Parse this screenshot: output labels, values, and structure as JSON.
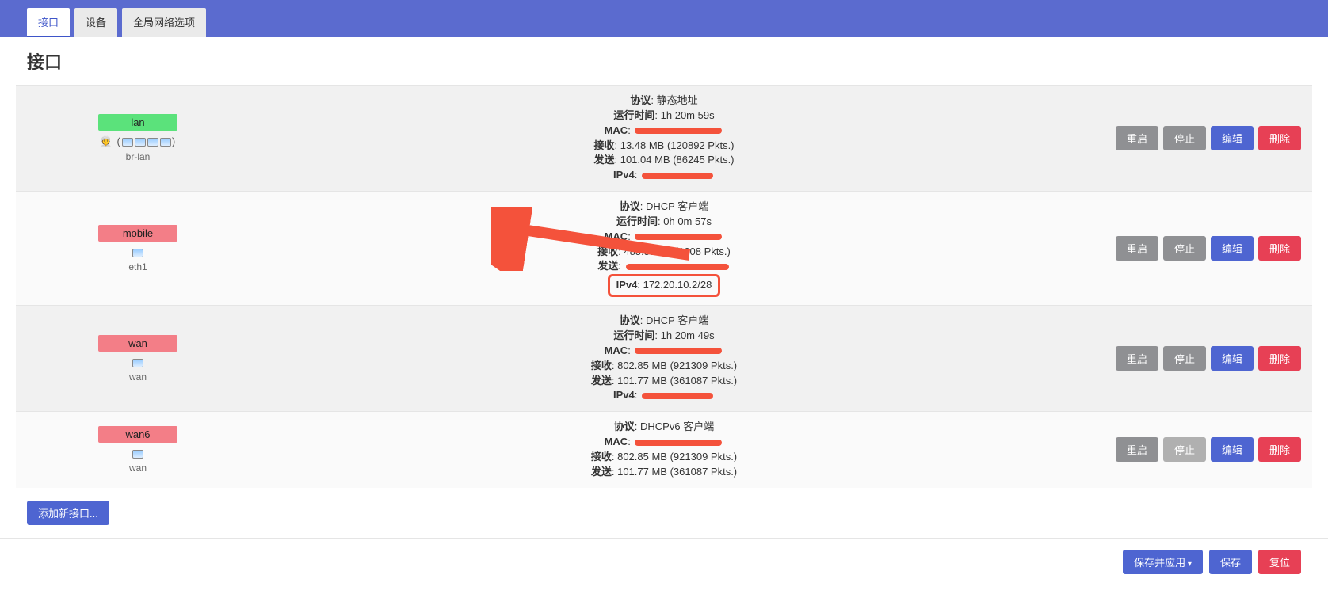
{
  "tabs": {
    "interfaces": "接口",
    "devices": "设备",
    "global": "全局网络选项"
  },
  "page_title": "接口",
  "labels": {
    "protocol": "协议",
    "uptime": "运行时间",
    "mac": "MAC",
    "rx": "接收",
    "tx": "发送",
    "ipv4": "IPv4"
  },
  "actions": {
    "restart": "重启",
    "stop": "停止",
    "edit": "编辑",
    "delete": "删除",
    "add": "添加新接口...",
    "save_apply": "保存并应用",
    "save": "保存",
    "reset": "复位"
  },
  "interfaces": [
    {
      "name": "lan",
      "badge_class": "badge-green",
      "device": "br-lan",
      "icons": 4,
      "protocol": "静态地址",
      "uptime": "1h 20m 59s",
      "mac_redacted": true,
      "rx": "13.48 MB (120892 Pkts.)",
      "tx": "101.04 MB (86245 Pkts.)",
      "ipv4_redacted": true,
      "ipv4": null,
      "stop_disabled": false
    },
    {
      "name": "mobile",
      "badge_class": "badge-red",
      "device": "eth1",
      "icons": 1,
      "protocol": "DHCP 客户端",
      "uptime": "0h 0m 57s",
      "mac_redacted": true,
      "rx": "485.58 KB (1608 Pkts.)",
      "tx_redacted": true,
      "ipv4": "172.20.10.2/28",
      "ipv4_highlight": true,
      "stop_disabled": false
    },
    {
      "name": "wan",
      "badge_class": "badge-red",
      "device": "wan",
      "icons": 1,
      "protocol": "DHCP 客户端",
      "uptime": "1h 20m 49s",
      "mac_redacted": true,
      "rx": "802.85 MB (921309 Pkts.)",
      "tx": "101.77 MB (361087 Pkts.)",
      "ipv4_redacted": true,
      "stop_disabled": false
    },
    {
      "name": "wan6",
      "badge_class": "badge-red",
      "device": "wan",
      "icons": 1,
      "protocol": "DHCPv6 客户端",
      "uptime": null,
      "mac_redacted": true,
      "rx": "802.85 MB (921309 Pkts.)",
      "tx": "101.77 MB (361087 Pkts.)",
      "ipv4": null,
      "stop_disabled": true
    }
  ]
}
